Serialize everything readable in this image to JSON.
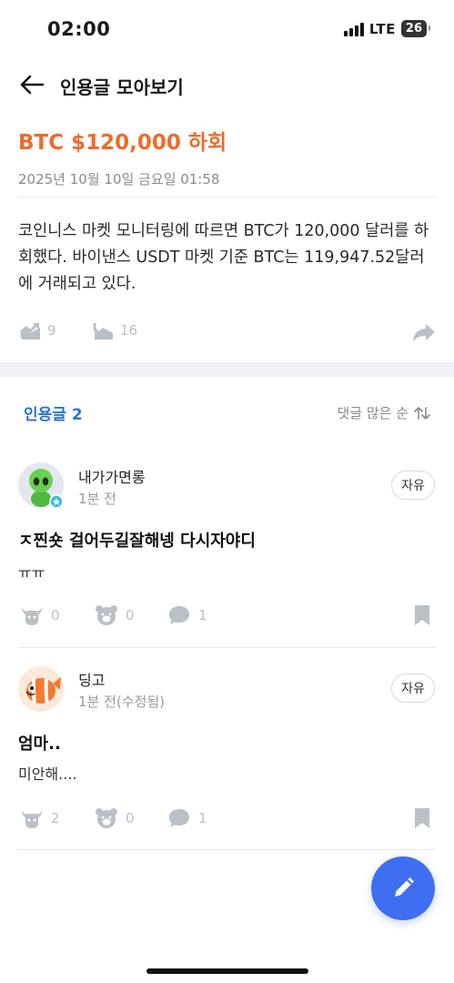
{
  "status_bar": {
    "time": "02:00",
    "network": "LTE",
    "battery": "26"
  },
  "nav": {
    "title": "인용글 모아보기"
  },
  "post": {
    "title": "BTC $120,000 하회",
    "date": "2025년 10월 10일 금요일 01:58",
    "body": "코인니스 마켓 모니터링에 따르면 BTC가 120,000 달러를 하회했다. 바이낸스 USDT 마켓 기준 BTC는 119,947.52달러에 거래되고 있다.",
    "bullish_count": "9",
    "bearish_count": "16"
  },
  "quotes": {
    "header": "인용글 2",
    "sort_label": "댓글 많은 순"
  },
  "comments": [
    {
      "author": "내가가면롱",
      "time": "1분 전",
      "tag": "자유",
      "title": "ㅈ찐숏 걸어두길잘해넹 다시자야디",
      "text": "ㅠㅠ",
      "bull": "0",
      "bear": "0",
      "replies": "1"
    },
    {
      "author": "딩고",
      "time": "1분 전(수정됨)",
      "tag": "자유",
      "title": "엄마..",
      "text": "미안해....",
      "bull": "2",
      "bear": "0",
      "replies": "1"
    }
  ],
  "colors": {
    "title_orange": "#ec6b2d",
    "link_blue": "#2872d8",
    "fab_blue": "#3f6ef0",
    "icon_gray": "#b9c0c8"
  }
}
